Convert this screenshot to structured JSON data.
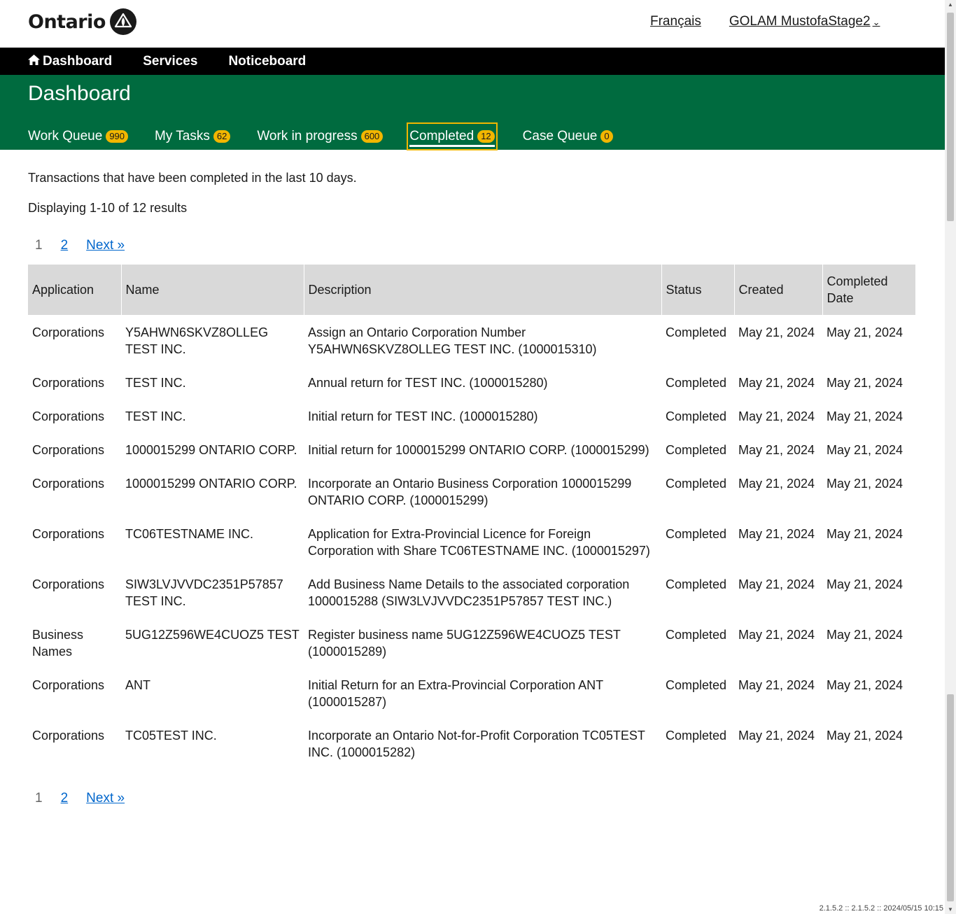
{
  "header": {
    "logo_text": "Ontario",
    "language_link": "Français",
    "user_menu": "GOLAM MustofaStage2"
  },
  "nav": {
    "items": [
      {
        "label": "Dashboard",
        "icon": "home-icon"
      },
      {
        "label": "Services"
      },
      {
        "label": "Noticeboard"
      }
    ]
  },
  "page": {
    "title": "Dashboard",
    "tabs": [
      {
        "label": "Work Queue",
        "count": "990"
      },
      {
        "label": "My Tasks",
        "count": "62"
      },
      {
        "label": "Work in progress",
        "count": "600"
      },
      {
        "label": "Completed",
        "count": "12",
        "active": true
      },
      {
        "label": "Case Queue",
        "count": "0"
      }
    ],
    "intro": "Transactions that have been completed in the last 10 days.",
    "results_text": "Displaying 1-10 of 12 results"
  },
  "pagination": {
    "current": "1",
    "page2": "2",
    "next": "Next »"
  },
  "table": {
    "columns": [
      "Application",
      "Name",
      "Description",
      "Status",
      "Created",
      "Completed Date"
    ],
    "rows": [
      [
        "Corporations",
        "Y5AHWN6SKVZ8OLLEG TEST INC.",
        "Assign an Ontario Corporation Number Y5AHWN6SKVZ8OLLEG TEST INC. (1000015310)",
        "Completed",
        "May 21, 2024",
        "May 21, 2024"
      ],
      [
        "Corporations",
        "TEST INC.",
        "Annual return for TEST INC. (1000015280)",
        "Completed",
        "May 21, 2024",
        "May 21, 2024"
      ],
      [
        "Corporations",
        "TEST INC.",
        "Initial return for TEST INC. (1000015280)",
        "Completed",
        "May 21, 2024",
        "May 21, 2024"
      ],
      [
        "Corporations",
        "1000015299 ONTARIO CORP.",
        "Initial return for 1000015299 ONTARIO CORP. (1000015299)",
        "Completed",
        "May 21, 2024",
        "May 21, 2024"
      ],
      [
        "Corporations",
        "1000015299 ONTARIO CORP.",
        "Incorporate an Ontario Business Corporation 1000015299 ONTARIO CORP. (1000015299)",
        "Completed",
        "May 21, 2024",
        "May 21, 2024"
      ],
      [
        "Corporations",
        "TC06TESTNAME INC.",
        "Application for Extra-Provincial Licence for Foreign Corporation with Share TC06TESTNAME INC. (1000015297)",
        "Completed",
        "May 21, 2024",
        "May 21, 2024"
      ],
      [
        "Corporations",
        "SIW3LVJVVDC2351P57857 TEST INC.",
        "Add Business Name Details to the associated corporation 1000015288 (SIW3LVJVVDC2351P57857 TEST INC.)",
        "Completed",
        "May 21, 2024",
        "May 21, 2024"
      ],
      [
        "Business Names",
        "5UG12Z596WE4CUOZ5 TEST",
        "Register business name 5UG12Z596WE4CUOZ5 TEST (1000015289)",
        "Completed",
        "May 21, 2024",
        "May 21, 2024"
      ],
      [
        "Corporations",
        "ANT",
        "Initial Return for an Extra-Provincial Corporation ANT (1000015287)",
        "Completed",
        "May 21, 2024",
        "May 21, 2024"
      ],
      [
        "Corporations",
        "TC05TEST INC.",
        "Incorporate an Ontario Not-for-Profit Corporation TC05TEST INC. (1000015282)",
        "Completed",
        "May 21, 2024",
        "May 21, 2024"
      ]
    ]
  },
  "footer": {
    "version": "2.1.5.2 :: 2.1.5.2 :: 2024/05/15 10:15"
  }
}
